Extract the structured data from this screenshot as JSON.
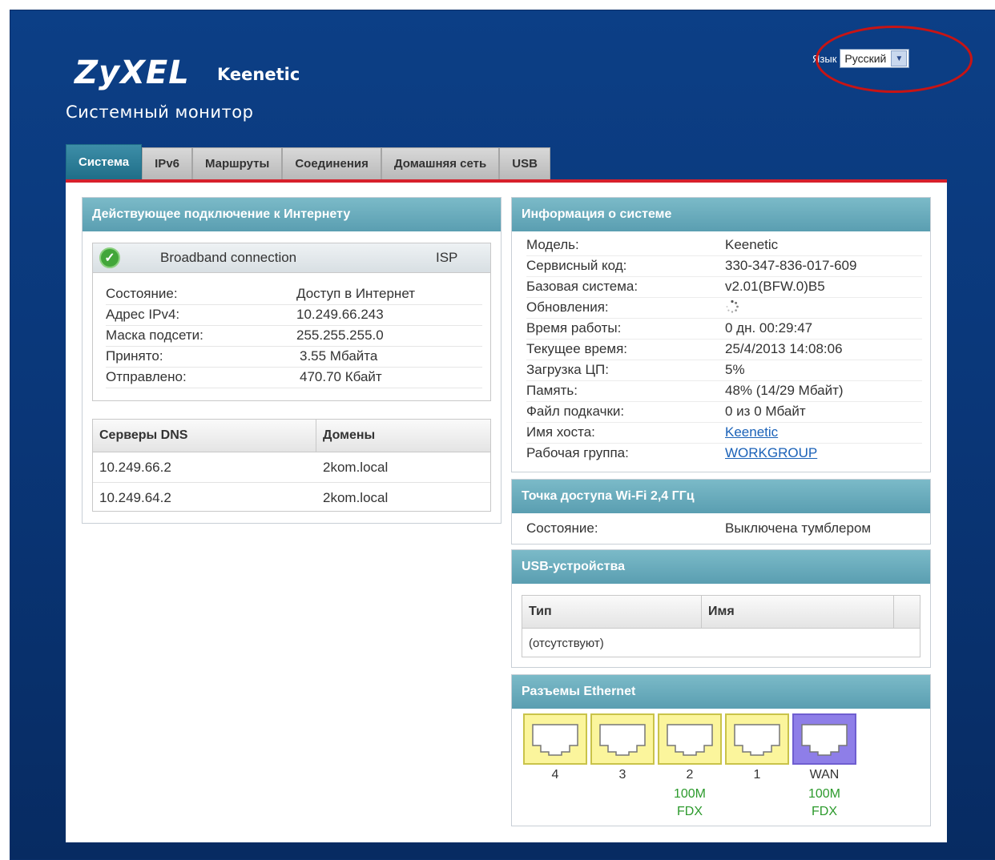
{
  "header": {
    "logo": "ZyXEL",
    "product": "Keenetic",
    "page_title": "Системный монитор",
    "language_label": "Язык",
    "language_value": "Русский"
  },
  "tabs": [
    {
      "label": "Система",
      "active": true
    },
    {
      "label": "IPv6"
    },
    {
      "label": "Маршруты"
    },
    {
      "label": "Соединения"
    },
    {
      "label": "Домашняя сеть"
    },
    {
      "label": "USB"
    }
  ],
  "internet": {
    "title": "Действующее подключение к Интернету",
    "connection_name": "Broadband connection",
    "connection_type": "ISP",
    "status_icon": "check-circle-icon",
    "rows": [
      {
        "label": "Состояние:",
        "value": "Доступ в Интернет"
      },
      {
        "label": "Адрес IPv4:",
        "value": "10.249.66.243"
      },
      {
        "label": "Маска подсети:",
        "value": "255.255.255.0"
      },
      {
        "label": "Принято:",
        "value": "3.55 Мбайта"
      },
      {
        "label": "Отправлено:",
        "value": "470.70 Кбайт"
      }
    ],
    "dns_header": "Серверы DNS",
    "domains_header": "Домены",
    "dns_rows": [
      {
        "server": "10.249.66.2",
        "domain": "2kom.local"
      },
      {
        "server": "10.249.64.2",
        "domain": "2kom.local"
      }
    ]
  },
  "system": {
    "title": "Информация о системе",
    "rows": [
      {
        "label": "Модель:",
        "value": "Keenetic"
      },
      {
        "label": "Сервисный код:",
        "value": "330-347-836-017-609"
      },
      {
        "label": "Базовая система:",
        "value": "v2.01(BFW.0)B5"
      },
      {
        "label": "Обновления:",
        "value": ""
      },
      {
        "label": "Время работы:",
        "value": "0 дн. 00:29:47"
      },
      {
        "label": "Текущее время:",
        "value": "25/4/2013 14:08:06"
      },
      {
        "label": "Загрузка ЦП:",
        "value": "5%"
      },
      {
        "label": "Память:",
        "value": "48% (14/29 Мбайт)"
      },
      {
        "label": "Файл подкачки:",
        "value": "0 из 0 Мбайт"
      },
      {
        "label": "Имя хоста:",
        "value": "Keenetic",
        "link": true
      },
      {
        "label": "Рабочая группа:",
        "value": "WORKGROUP",
        "link": true
      }
    ]
  },
  "wifi": {
    "title": "Точка доступа Wi-Fi 2,4 ГГц",
    "label": "Состояние:",
    "value": "Выключена тумблером"
  },
  "usb": {
    "title": "USB-устройства",
    "col_type": "Тип",
    "col_name": "Имя",
    "empty": "(отсутствуют)"
  },
  "ethernet": {
    "title": "Разъемы Ethernet",
    "ports": [
      {
        "label": "4",
        "speed": "",
        "duplex": "",
        "kind": "lan"
      },
      {
        "label": "3",
        "speed": "",
        "duplex": "",
        "kind": "lan"
      },
      {
        "label": "2",
        "speed": "100M",
        "duplex": "FDX",
        "kind": "lan"
      },
      {
        "label": "1",
        "speed": "",
        "duplex": "",
        "kind": "lan"
      },
      {
        "label": "WAN",
        "speed": "100M",
        "duplex": "FDX",
        "kind": "wan"
      }
    ]
  },
  "colors": {
    "background": "#0a3779",
    "accent_red": "#d7202b",
    "panel_header": "#5a9eb1",
    "lan_port": "#fbf59c",
    "wan_port": "#8e7ee8",
    "link_speed": "#2c9a2c"
  }
}
